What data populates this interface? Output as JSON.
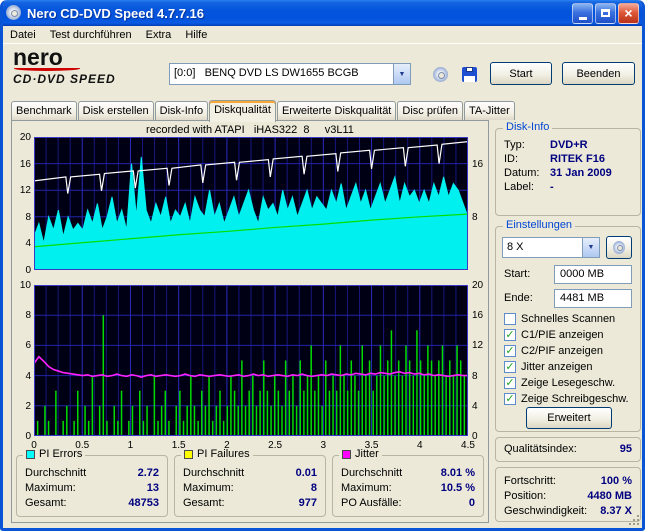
{
  "window": {
    "title": "Nero CD-DVD Speed 4.7.7.16"
  },
  "menubar": {
    "items": [
      "Datei",
      "Test durchführen",
      "Extra",
      "Hilfe"
    ]
  },
  "logo": {
    "line1": "nero",
    "line2": "CD·DVD SPEED"
  },
  "toolbar": {
    "drive": "[0:0]   BENQ DVD LS DW1655 BCGB",
    "start_label": "Start",
    "quit_label": "Beenden"
  },
  "tabs": {
    "items": [
      {
        "label": "Benchmark",
        "active": false
      },
      {
        "label": "Disk erstellen",
        "active": false
      },
      {
        "label": "Disk-Info",
        "active": false
      },
      {
        "label": "Diskqualität",
        "active": true
      },
      {
        "label": "Erweiterte Diskqualität",
        "active": false
      },
      {
        "label": "Disc prüfen",
        "active": false
      },
      {
        "label": "TA-Jitter",
        "active": false
      }
    ]
  },
  "panel": {
    "header": "recorded with ATAPI   iHAS322  8     v3L11"
  },
  "disk_info": {
    "title": "Disk-Info",
    "rows": [
      {
        "label": "Typ:",
        "value": "DVD+R"
      },
      {
        "label": "ID:",
        "value": "RITEK F16"
      },
      {
        "label": "Datum:",
        "value": "31 Jan 2009"
      },
      {
        "label": "Label:",
        "value": "-"
      }
    ]
  },
  "einstellungen": {
    "title": "Einstellungen",
    "speed": "8 X",
    "start_label": "Start:",
    "start_value": "0000 MB",
    "ende_label": "Ende:",
    "ende_value": "4481 MB",
    "checkboxes": [
      {
        "label": "Schnelles Scannen",
        "checked": false
      },
      {
        "label": "C1/PIE anzeigen",
        "checked": true
      },
      {
        "label": "C2/PIF anzeigen",
        "checked": true
      },
      {
        "label": "Jitter anzeigen",
        "checked": true
      },
      {
        "label": "Zeige Lesegeschw.",
        "checked": true
      },
      {
        "label": "Zeige Schreibgeschw.",
        "checked": true
      }
    ],
    "erweitert_label": "Erweitert"
  },
  "quality": {
    "label": "Qualitätsindex:",
    "value": "95"
  },
  "progress": {
    "rows": [
      {
        "label": "Fortschritt:",
        "value": "100 %"
      },
      {
        "label": "Position:",
        "value": "4480 MB"
      },
      {
        "label": "Geschwindigkeit:",
        "value": "8.37 X"
      }
    ]
  },
  "stats": {
    "boxes": [
      {
        "title": "PI Errors",
        "chip_color": "#00FFFF",
        "rows": [
          {
            "label": "Durchschnitt",
            "value": "2.72"
          },
          {
            "label": "Maximum:",
            "value": "13"
          },
          {
            "label": "Gesamt:",
            "value": "48753"
          }
        ]
      },
      {
        "title": "PI Failures",
        "chip_color": "#FFFF00",
        "rows": [
          {
            "label": "Durchschnitt",
            "value": "0.01"
          },
          {
            "label": "Maximum:",
            "value": "8"
          },
          {
            "label": "Gesamt:",
            "value": "977"
          }
        ]
      },
      {
        "title": "Jitter",
        "chip_color": "#FF00FF",
        "rows": [
          {
            "label": "Durchschnitt",
            "value": "8.01 %"
          },
          {
            "label": "Maximum:",
            "value": "10.5 %"
          },
          {
            "label": "PO Ausfälle:",
            "value": "0"
          }
        ]
      }
    ]
  },
  "chart_data": [
    {
      "type": "area",
      "name": "pi-errors-graph",
      "x_range": [
        0,
        4.5
      ],
      "x_ticks": [],
      "y_left": {
        "min": 0,
        "max": 20,
        "ticks": [
          20,
          16,
          12,
          8,
          4,
          0
        ]
      },
      "y_right": {
        "min": 0,
        "max": 20,
        "ticks": [
          16,
          8
        ]
      },
      "series": [
        {
          "name": "pi-errors",
          "type": "area",
          "color": "#00F0F0",
          "values": [
            5,
            7,
            4,
            8,
            6,
            9,
            5,
            8,
            6,
            7,
            6,
            9,
            7,
            10,
            6,
            8,
            11,
            7,
            9,
            6,
            16,
            8,
            17,
            9,
            7,
            10,
            8,
            11,
            7,
            9,
            8,
            10,
            7,
            11,
            9,
            8,
            12,
            8,
            10,
            7,
            9,
            11,
            8,
            10,
            12,
            9,
            7,
            11,
            9,
            10,
            8,
            12,
            9,
            11,
            8,
            10,
            12,
            9,
            11,
            10,
            9,
            12,
            10,
            13,
            9,
            11,
            13,
            10,
            12,
            9,
            11,
            13,
            10,
            12,
            14,
            10,
            13,
            11,
            12,
            10,
            12,
            10,
            13,
            11,
            14,
            11,
            13,
            12,
            10,
            8
          ]
        },
        {
          "name": "write-speed",
          "type": "line",
          "color": "#00E000",
          "points": [
            [
              0,
              3.5
            ],
            [
              0.5,
              4.1
            ],
            [
              1,
              4.7
            ],
            [
              1.5,
              5.3
            ],
            [
              2,
              5.8
            ],
            [
              2.5,
              6.4
            ],
            [
              3,
              6.9
            ],
            [
              3.5,
              7.5
            ],
            [
              4,
              8.0
            ],
            [
              4.5,
              8.4
            ]
          ]
        },
        {
          "name": "read-speed",
          "type": "line",
          "color": "#FFFFFF",
          "points": [
            [
              0,
              13.4
            ],
            [
              0.33,
              14.0
            ],
            [
              0.35,
              11.5
            ],
            [
              0.38,
              14.0
            ],
            [
              0.68,
              14.4
            ],
            [
              0.7,
              11.9
            ],
            [
              0.73,
              14.5
            ],
            [
              1.03,
              14.9
            ],
            [
              1.05,
              12.3
            ],
            [
              1.08,
              14.9
            ],
            [
              1.38,
              15.3
            ],
            [
              1.4,
              12.7
            ],
            [
              1.43,
              15.3
            ],
            [
              1.73,
              15.8
            ],
            [
              1.75,
              13.1
            ],
            [
              1.78,
              15.8
            ],
            [
              2.08,
              16.2
            ],
            [
              2.1,
              13.5
            ],
            [
              2.13,
              16.2
            ],
            [
              2.43,
              16.6
            ],
            [
              2.45,
              14.0
            ],
            [
              2.48,
              16.7
            ],
            [
              2.78,
              17.1
            ],
            [
              2.8,
              14.4
            ],
            [
              2.83,
              17.1
            ],
            [
              3.13,
              17.5
            ],
            [
              3.15,
              14.8
            ],
            [
              3.18,
              17.6
            ],
            [
              3.48,
              18.0
            ],
            [
              3.5,
              15.2
            ],
            [
              3.53,
              18.0
            ],
            [
              3.83,
              18.4
            ],
            [
              3.85,
              15.6
            ],
            [
              3.88,
              18.4
            ],
            [
              4.18,
              18.8
            ],
            [
              4.2,
              16.0
            ],
            [
              4.23,
              18.9
            ],
            [
              4.5,
              19.3
            ]
          ]
        }
      ]
    },
    {
      "type": "bar",
      "name": "pi-failures-graph",
      "x_range": [
        0,
        4.5
      ],
      "x_ticks": [
        0,
        0.5,
        1,
        1.5,
        2,
        2.5,
        3,
        3.5,
        4,
        4.5
      ],
      "y_left": {
        "min": 0,
        "max": 10,
        "ticks": [
          10,
          8,
          6,
          4,
          2,
          0
        ]
      },
      "y_right": {
        "min": 0,
        "max": 20,
        "ticks": [
          20,
          16,
          12,
          8,
          4,
          0
        ]
      },
      "series": [
        {
          "name": "pi-failures",
          "type": "bars",
          "color": "#00DC00",
          "values": [
            0,
            1,
            0,
            2,
            1,
            0,
            3,
            0,
            1,
            2,
            0,
            1,
            3,
            0,
            2,
            1,
            4,
            0,
            2,
            8,
            1,
            0,
            2,
            1,
            3,
            0,
            1,
            2,
            0,
            3,
            1,
            2,
            0,
            4,
            1,
            2,
            3,
            1,
            0,
            2,
            3,
            1,
            2,
            4,
            2,
            1,
            3,
            2,
            4,
            1,
            2,
            3,
            1,
            2,
            4,
            3,
            2,
            5,
            2,
            3,
            4,
            2,
            3,
            5,
            3,
            2,
            4,
            3,
            2,
            5,
            3,
            4,
            2,
            5,
            3,
            4,
            6,
            3,
            4,
            2,
            5,
            3,
            4,
            3,
            6,
            4,
            3,
            5,
            4,
            3,
            6,
            4,
            5,
            3,
            4,
            6,
            4,
            5,
            7,
            4,
            5,
            4,
            6,
            5,
            4,
            7,
            5,
            4,
            6,
            5,
            4,
            5,
            6,
            4,
            5,
            4,
            6,
            5,
            4,
            3
          ]
        },
        {
          "name": "jitter",
          "type": "line",
          "axis": "right",
          "color": "#FF22FF",
          "values": [
            9.6,
            10.5,
            9.9,
            9.2,
            8.8,
            8.6,
            8.4,
            8.3,
            8.2,
            8.1,
            8.0,
            8.1,
            7.9,
            8.0,
            8.1,
            7.9,
            8.0,
            8.2,
            8.0,
            7.9,
            8.1,
            8.0,
            7.8,
            8.0,
            8.1,
            7.9,
            8.0,
            8.1,
            8.0,
            7.9,
            8.0,
            8.2,
            8.0,
            7.9,
            8.1,
            8.0,
            7.9,
            8.0,
            8.1,
            8.0,
            7.9,
            8.0,
            8.1,
            7.9,
            8.0,
            8.2,
            8.0,
            8.1,
            7.9,
            8.0,
            8.1,
            8.0,
            7.9,
            8.1,
            8.0,
            8.2,
            8.0,
            7.9,
            8.0,
            8.1,
            8.0,
            8.2,
            8.1,
            8.0,
            8.2,
            8.1,
            8.3,
            8.2,
            8.1,
            8.3,
            8.2,
            8.4,
            8.3,
            8.2,
            8.4,
            8.5,
            8.3,
            8.4,
            8.2,
            8.3,
            8.1,
            8.2,
            8.0,
            8.1,
            8.0,
            7.9,
            8.0,
            8.1,
            8.0,
            8.0
          ]
        }
      ]
    }
  ]
}
